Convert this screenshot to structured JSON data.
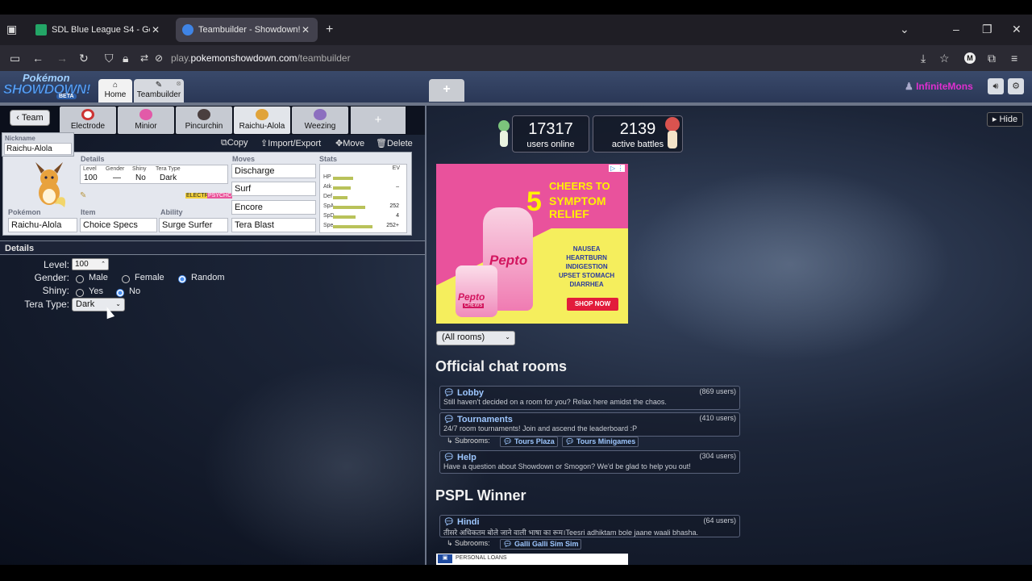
{
  "browser": {
    "tabs": [
      {
        "title": "SDL Blue League S4 - Google Sh",
        "icon": "sheets-icon",
        "color": "#23a566"
      },
      {
        "title": "Teambuilder - Showdown!",
        "icon": "showdown-icon",
        "color": "#3f84e5"
      }
    ],
    "url_prefix": "play.",
    "url_host": "pokemonshowdown.com",
    "url_path": "/teambuilder",
    "profile_initial": "M"
  },
  "header": {
    "logo_top": "Pokémon",
    "logo_main": "SHOWDOWN!",
    "logo_badge": "BETA",
    "tabs": [
      {
        "label": "Home",
        "icon": "home-icon"
      },
      {
        "label": "Teambuilder",
        "icon": "edit-icon"
      }
    ],
    "new_tab": "+",
    "username": "InfiniteMons"
  },
  "teambuilder": {
    "team_button": "Team",
    "pokemon_tabs": [
      "Electrode",
      "Minior",
      "Pincurchin",
      "Raichu-Alola",
      "Weezing"
    ],
    "add_tab": "+",
    "actions": {
      "copy": "Copy",
      "import_export": "Import/Export",
      "move": "Move",
      "delete": "Delete"
    },
    "set": {
      "nickname_label": "Nickname",
      "nickname": "Raichu-Alola",
      "details_label": "Details",
      "level_label": "Level",
      "level": "100",
      "gender_label": "Gender",
      "gender": "—",
      "shiny_label": "Shiny",
      "shiny": "No",
      "tera_label": "Tera Type",
      "tera": "Dark",
      "types": [
        "ELECTR",
        "PSYCHC"
      ],
      "pokemon_label": "Pokémon",
      "pokemon": "Raichu-Alola",
      "item_label": "Item",
      "item": "Choice Specs",
      "ability_label": "Ability",
      "ability": "Surge Surfer",
      "moves_label": "Moves",
      "moves": [
        "Discharge",
        "Surf",
        "Encore",
        "Tera Blast"
      ],
      "stats_label": "Stats",
      "ev_label": "EV",
      "stats": [
        {
          "name": "HP",
          "ev": "",
          "fill": 0.42
        },
        {
          "name": "Atk",
          "ev": "–",
          "fill": 0.36
        },
        {
          "name": "Def",
          "ev": "",
          "fill": 0.3
        },
        {
          "name": "SpA",
          "ev": "252",
          "fill": 0.66
        },
        {
          "name": "SpD",
          "ev": "4",
          "fill": 0.46
        },
        {
          "name": "Spe",
          "ev": "252+",
          "fill": 0.82
        }
      ]
    },
    "details": {
      "heading": "Details",
      "level_label": "Level:",
      "level_value": "100",
      "gender_label": "Gender:",
      "gender_options": [
        "Male",
        "Female",
        "Random"
      ],
      "gender_selected": "Random",
      "shiny_label": "Shiny:",
      "shiny_options": [
        "Yes",
        "No"
      ],
      "shiny_selected": "No",
      "tera_label": "Tera Type:",
      "tera_value": "Dark"
    }
  },
  "lobby": {
    "hide_button": "Hide",
    "users_online": "17317",
    "users_online_label": "users online",
    "active_battles": "2139",
    "active_battles_label": "active battles",
    "ad": {
      "headline_1": "CHEERS TO",
      "headline_number": "5",
      "headline_2": "SYMPTOM",
      "headline_3": "RELIEF",
      "symptoms": [
        "NAUSEA",
        "HEARTBURN",
        "INDIGESTION",
        "UPSET STOMACH",
        "DIARRHEA"
      ],
      "cta": "SHOP NOW",
      "brand": "Pepto",
      "brand_small": "Pepto",
      "chews": "CHEWS"
    },
    "rooms_filter": "(All rooms)",
    "official_title": "Official chat rooms",
    "official_rooms": [
      {
        "name": "Lobby",
        "users": "(869 users)",
        "desc": "Still haven't decided on a room for you? Relax here amidst the chaos."
      },
      {
        "name": "Tournaments",
        "users": "(410 users)",
        "desc": "24/7 room tournaments! Join and ascend the leaderboard :P"
      },
      {
        "name": "Help",
        "users": "(304 users)",
        "desc": "Have a question about Showdown or Smogon? We'd be glad to help you out!"
      }
    ],
    "subrooms_label": "Subrooms:",
    "tournament_subrooms": [
      "Tours Plaza",
      "Tours Minigames"
    ],
    "pspl_title": "PSPL Winner",
    "pspl_rooms": [
      {
        "name": "Hindi",
        "users": "(64 users)",
        "desc": "तीसरे अधिकतम बोले जाने वाली भाषा का रूम।Teesri adhiktam bole jaane waali bhasha."
      }
    ],
    "hindi_subrooms": [
      "Galli Galli Sim Sim"
    ],
    "ad2_text": "PERSONAL LOANS"
  }
}
